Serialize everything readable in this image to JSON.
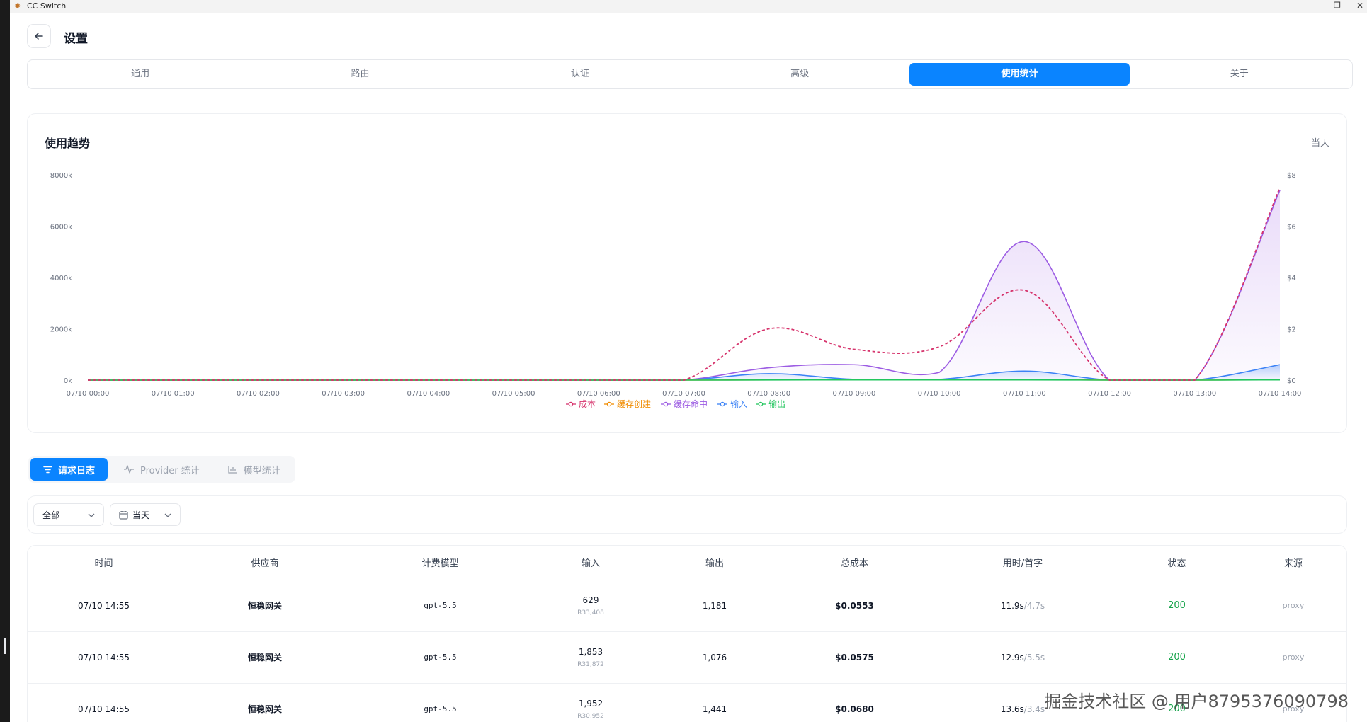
{
  "window": {
    "title": "CC Switch",
    "minimize": "–",
    "maximize": "❐",
    "close": "✕"
  },
  "header": {
    "back_icon": "arrow-left-icon",
    "title": "设置"
  },
  "tabs": [
    {
      "label": "通用",
      "active": false
    },
    {
      "label": "路由",
      "active": false
    },
    {
      "label": "认证",
      "active": false
    },
    {
      "label": "高级",
      "active": false
    },
    {
      "label": "使用统计",
      "active": true
    },
    {
      "label": "关于",
      "active": false
    }
  ],
  "trend": {
    "title": "使用趋势",
    "range": "当天"
  },
  "colors": {
    "accent": "#0a84ff",
    "cost": "#d6336c",
    "cache_create": "#f08c00",
    "cache_hit": "#9c5ce3",
    "input": "#3b82f6",
    "output": "#22c55e",
    "status_ok": "#16a34a"
  },
  "chart_data": {
    "type": "line",
    "x": [
      "07/10 00:00",
      "07/10 01:00",
      "07/10 02:00",
      "07/10 03:00",
      "07/10 04:00",
      "07/10 05:00",
      "07/10 06:00",
      "07/10 07:00",
      "07/10 08:00",
      "07/10 09:00",
      "07/10 10:00",
      "07/10 11:00",
      "07/10 12:00",
      "07/10 13:00",
      "07/10 14:00"
    ],
    "y_left": {
      "ticks": [
        "0k",
        "2000k",
        "4000k",
        "6000k",
        "8000k"
      ],
      "lim": [
        0,
        8000
      ]
    },
    "y_right": {
      "ticks": [
        "$0",
        "$2",
        "$4",
        "$6",
        "$8"
      ],
      "lim": [
        0,
        8
      ]
    },
    "series": [
      {
        "name": "成本",
        "axis": "right",
        "style": "dashed",
        "values": [
          0,
          0,
          0,
          0,
          0,
          0,
          0,
          0,
          2.0,
          1.2,
          1.3,
          3.5,
          0,
          0,
          7.5
        ]
      },
      {
        "name": "缓存创建",
        "axis": "left",
        "values": [
          0,
          0,
          0,
          0,
          0,
          0,
          0,
          0,
          10,
          20,
          15,
          20,
          0,
          0,
          15
        ]
      },
      {
        "name": "缓存命中",
        "axis": "left",
        "fill": true,
        "values": [
          0,
          0,
          0,
          0,
          0,
          0,
          0,
          0,
          480,
          600,
          300,
          5400,
          0,
          0,
          7400
        ]
      },
      {
        "name": "输入",
        "axis": "left",
        "fill": true,
        "values": [
          0,
          0,
          0,
          0,
          0,
          0,
          0,
          0,
          250,
          30,
          30,
          350,
          0,
          0,
          600
        ]
      },
      {
        "name": "输出",
        "axis": "left",
        "values": [
          0,
          0,
          0,
          0,
          0,
          0,
          0,
          0,
          5,
          10,
          8,
          10,
          0,
          0,
          10
        ]
      }
    ]
  },
  "subtabs": [
    {
      "label": "请求日志",
      "icon": "filter-icon",
      "active": true
    },
    {
      "label": "Provider 统计",
      "icon": "activity-icon",
      "active": false
    },
    {
      "label": "模型统计",
      "icon": "bar-chart-icon",
      "active": false
    }
  ],
  "filters": {
    "scope": "全部",
    "date": "当天",
    "chevron": "⌄",
    "calendar_icon": "calendar-icon"
  },
  "table": {
    "columns": [
      "时间",
      "供应商",
      "计费模型",
      "输入",
      "输出",
      "总成本",
      "用时/首字",
      "状态",
      "来源"
    ],
    "rows": [
      {
        "time": "07/10 14:55",
        "provider": "恒稳网关",
        "model": "gpt-5.5",
        "input": "629",
        "input_sub": "R33,408",
        "output": "1,181",
        "cost": "$0.0553",
        "duration": "11.9s",
        "first": "/4.7s",
        "status": "200",
        "source": "proxy"
      },
      {
        "time": "07/10 14:55",
        "provider": "恒稳网关",
        "model": "gpt-5.5",
        "input": "1,853",
        "input_sub": "R31,872",
        "output": "1,076",
        "cost": "$0.0575",
        "duration": "12.9s",
        "first": "/5.5s",
        "status": "200",
        "source": "proxy"
      },
      {
        "time": "07/10 14:55",
        "provider": "恒稳网关",
        "model": "gpt-5.5",
        "input": "1,952",
        "input_sub": "R30,952",
        "output": "1,441",
        "cost": "$0.0680",
        "duration": "13.6s",
        "first": "/3.4s",
        "status": "200",
        "source": "proxy"
      }
    ]
  },
  "watermark": "掘金技术社区 @ 用户8795376090798"
}
